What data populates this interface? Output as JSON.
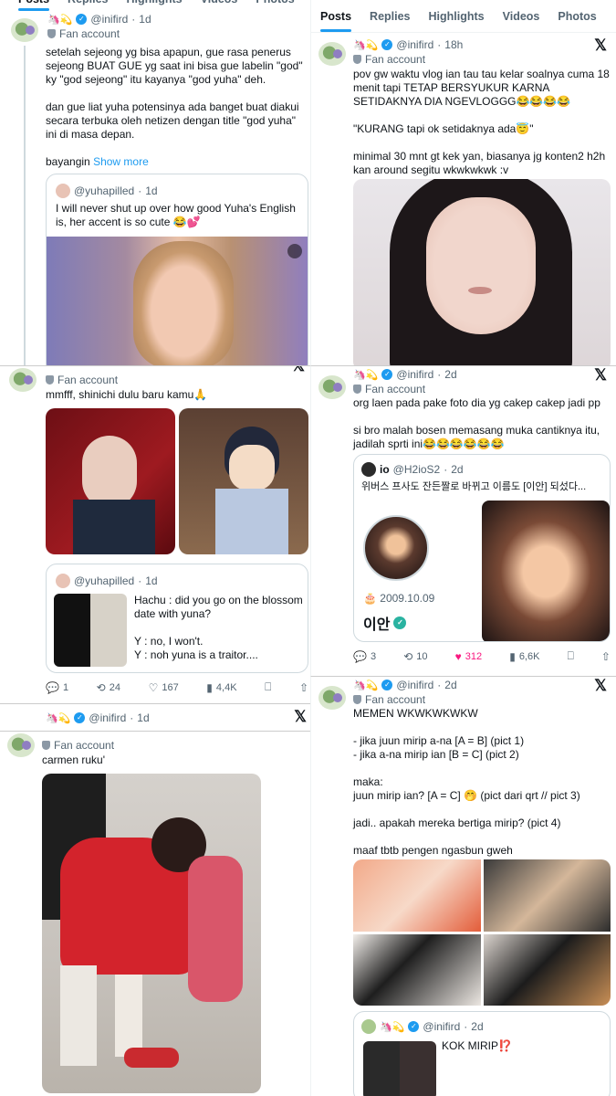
{
  "tabs": [
    "Posts",
    "Replies",
    "Highlights",
    "Videos",
    "Photos"
  ],
  "user": {
    "handle": "@inifird",
    "fan_label": "Fan account",
    "emojis": "🦄💫"
  },
  "post1": {
    "time": "1d",
    "text": "setelah sejeong yg bisa apapun, gue rasa penerus sejeong BUAT GUE yg saat ini bisa gue labelin \"god\" ky \"god sejeong\" itu kayanya \"god yuha\" deh.\n\ndan gue liat yuha potensinya ada banget buat diakui secara terbuka oleh netizen dengan title \"god yuha\" ini di masa depan.\n\nbayangin",
    "show_more": "Show more",
    "quote": {
      "handle": "@yuhapilled",
      "time": "1d",
      "text": "I will never shut up over how good Yuha's English is, her accent is so cute 😂💕"
    }
  },
  "post2": {
    "time": "18h",
    "text": "pov gw waktu vlog ian tau tau kelar soalnya cuma 18 menit tapi TETAP BERSYUKUR KARNA SETIDAKNYA DIA NGEVLOGGG😂😂😂😂\n\n\"KURANG tapi ok setidaknya ada😇\"\n\nminimal 30 mnt gt kek yan, biasanya jg konten2 h2h kan around segitu wkwkwkwk :v"
  },
  "post3": {
    "text": "mmfff, shinichi dulu baru kamu🙏",
    "quote": {
      "handle": "@yuhapilled",
      "time": "1d",
      "text": "Hachu : did you go on the blossom date with yuna?\n\nY : no, I won't.\nY : noh yuna is a traitor...."
    },
    "stats": {
      "replies": "1",
      "reposts": "24",
      "likes": "167",
      "views": "4,4K"
    }
  },
  "post4": {
    "time": "2d",
    "text": "org laen pada pake foto dia yg cakep cakep jadi pp\n\nsi bro malah bosen memasang muka cantiknya itu, jadilah sprti ini😂😂😂😂😂😂",
    "quote": {
      "name": "io",
      "handle": "@H2ioS2",
      "time": "2d",
      "text": "위버스 프사도 잔든짤로 바뀌고 이름도 [이안] 되섰다...",
      "date": "2009.10.09",
      "profile_name": "이안"
    },
    "stats": {
      "replies": "3",
      "reposts": "10",
      "likes": "312",
      "views": "6,6K"
    }
  },
  "post5": {
    "time": "1d"
  },
  "post6": {
    "time": "2d",
    "text": "carmen ruku'"
  },
  "post7": {
    "time": "2d",
    "text": "MEMEN WKWKWKWKW\n\n- jika juun mirip a-na [A = B] (pict 1)\n- jika a-na mirip ian [B = C] (pict 2)\n\nmaka:\njuun mirip ian? [A = C] 🤭 (pict dari qrt // pict 3)\n\njadi.. apakah mereka bertiga mirip? (pict 4)\n\nmaaf tbtb pengen ngasbun gweh",
    "quote": {
      "handle": "@inifird",
      "time": "2d",
      "text": "KOK MIRIP⁉️"
    }
  }
}
